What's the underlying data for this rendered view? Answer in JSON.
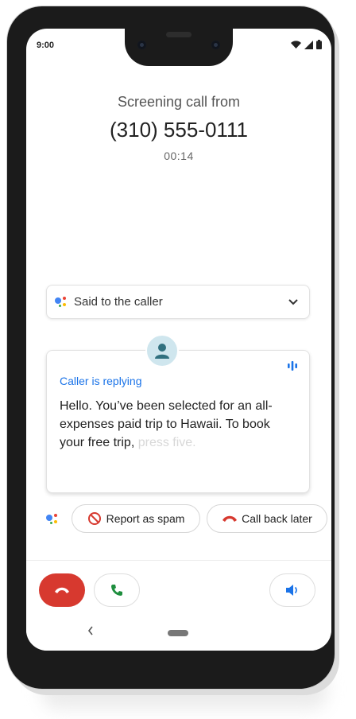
{
  "status_bar": {
    "time": "9:00"
  },
  "header": {
    "screening_label": "Screening call from",
    "phone_number": "(310) 555-0111",
    "timer": "00:14"
  },
  "said_card": {
    "label": "Said to the caller"
  },
  "reply_card": {
    "status": "Caller is replying",
    "transcript_visible": "Hello. You’ve been selected for an all-expenses paid trip to Hawaii. To book your free trip,",
    "transcript_faded": " press five."
  },
  "actions": {
    "report_spam_label": "Report as spam",
    "call_back_label": "Call back later"
  },
  "colors": {
    "accent_blue": "#1a73e8",
    "decline_red": "#d7392f",
    "answer_green": "#1e8e3e",
    "assistant_blue": "#4285f4",
    "assistant_red": "#ea4335",
    "assistant_yellow": "#fbbc04",
    "assistant_green": "#34a853"
  },
  "icons": {
    "signal": "cellular-signal-icon",
    "wifi": "wifi-icon",
    "battery": "battery-icon",
    "assistant": "google-assistant-icon",
    "expand": "chevron-down-icon",
    "avatar": "person-icon",
    "audio_bars": "audio-bars-icon",
    "spam": "block-icon",
    "hangup": "hang-up-icon",
    "answer": "phone-icon",
    "speaker": "speaker-icon",
    "back": "back-icon",
    "home": "home-icon"
  }
}
